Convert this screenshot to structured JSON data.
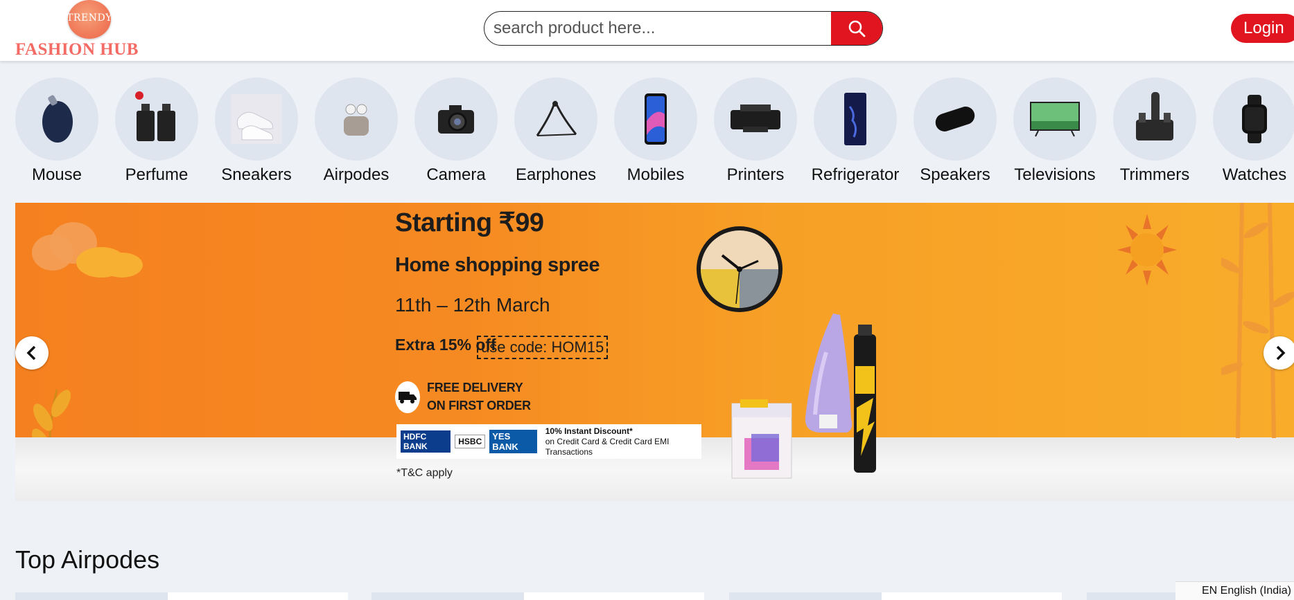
{
  "header": {
    "logo_top": "TRENDY",
    "logo_text": "FASHION HUB",
    "search_placeholder": "search product here...",
    "login_label": "Login"
  },
  "categories": [
    {
      "label": "Mouse",
      "icon": "mouse-icon"
    },
    {
      "label": "Perfume",
      "icon": "perfume-icon"
    },
    {
      "label": "Sneakers",
      "icon": "sneakers-icon"
    },
    {
      "label": "Airpodes",
      "icon": "airpods-icon"
    },
    {
      "label": "Camera",
      "icon": "camera-icon"
    },
    {
      "label": "Earphones",
      "icon": "earphones-icon"
    },
    {
      "label": "Mobiles",
      "icon": "mobile-icon"
    },
    {
      "label": "Printers",
      "icon": "printer-icon"
    },
    {
      "label": "Refrigerator",
      "icon": "refrigerator-icon"
    },
    {
      "label": "Speakers",
      "icon": "speaker-icon"
    },
    {
      "label": "Televisions",
      "icon": "television-icon"
    },
    {
      "label": "Trimmers",
      "icon": "trimmer-icon"
    },
    {
      "label": "Watches",
      "icon": "watch-icon"
    }
  ],
  "banner": {
    "starting": "Starting ₹99",
    "headline": "Home shopping spree",
    "dates": "11th – 12th March",
    "extra": "Extra 15% off",
    "code": "use code: HOM15",
    "delivery_line1": "FREE DELIVERY",
    "delivery_line2": "ON FIRST ORDER",
    "banks": [
      "HDFC BANK",
      "HSBC",
      "YES BANK"
    ],
    "discount_line1": "10% Instant Discount*",
    "discount_line2": "on Credit Card & Credit Card EMI Transactions",
    "tc": "*T&C apply"
  },
  "section": {
    "title": "Top Airpodes"
  },
  "status": {
    "language": "EN English (India)"
  },
  "colors": {
    "accent": "#e0151f",
    "banner_orange": "#f68a22",
    "logo_text": "#f46a64"
  }
}
